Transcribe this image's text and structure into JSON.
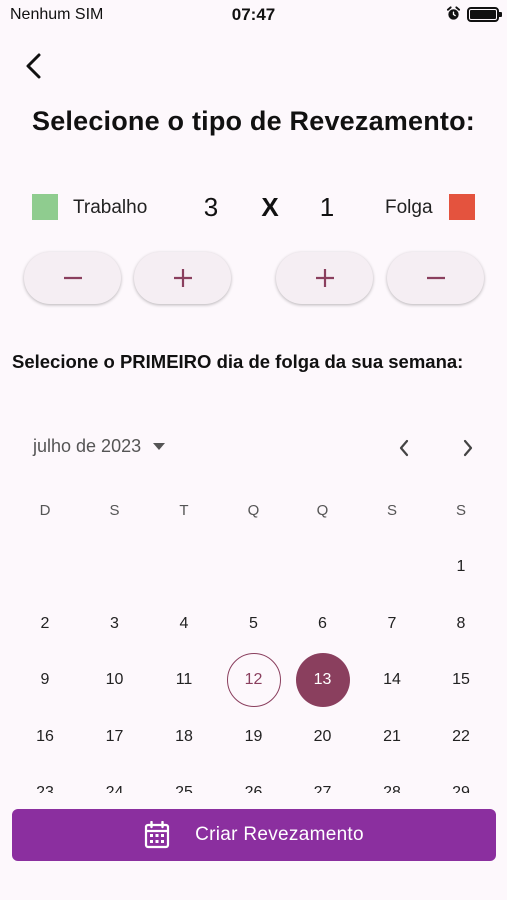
{
  "status_bar": {
    "carrier": "Nenhum SIM",
    "time": "07:47",
    "icons": [
      "alarm-icon",
      "battery-icon"
    ]
  },
  "header": {
    "back_icon": "chevron-left-icon",
    "title": "Selecione o tipo de Revezamento:"
  },
  "ratio": {
    "work_label": "Trabalho",
    "work_color": "#8fcc8f",
    "work_count": "3",
    "separator": "X",
    "off_count": "1",
    "off_label": "Folga",
    "off_color": "#e4533e",
    "buttons": [
      {
        "symbol": "minus",
        "action": "decrease-work"
      },
      {
        "symbol": "plus",
        "action": "increase-work"
      },
      {
        "symbol": "plus",
        "action": "increase-off"
      },
      {
        "symbol": "minus",
        "action": "decrease-off"
      }
    ]
  },
  "instruction": "Selecione o PRIMEIRO dia de folga da sua semana:",
  "calendar": {
    "month_label": "julho de 2023",
    "weekdays": [
      "D",
      "S",
      "T",
      "Q",
      "Q",
      "S",
      "S"
    ],
    "first_weekday_index": 6,
    "days_in_month": 31,
    "today": 12,
    "selected": 13,
    "accent": "#8a3f5e"
  },
  "create_button": {
    "label": "Criar Revezamento",
    "icon": "calendar-icon",
    "color": "#8b2f9f"
  }
}
